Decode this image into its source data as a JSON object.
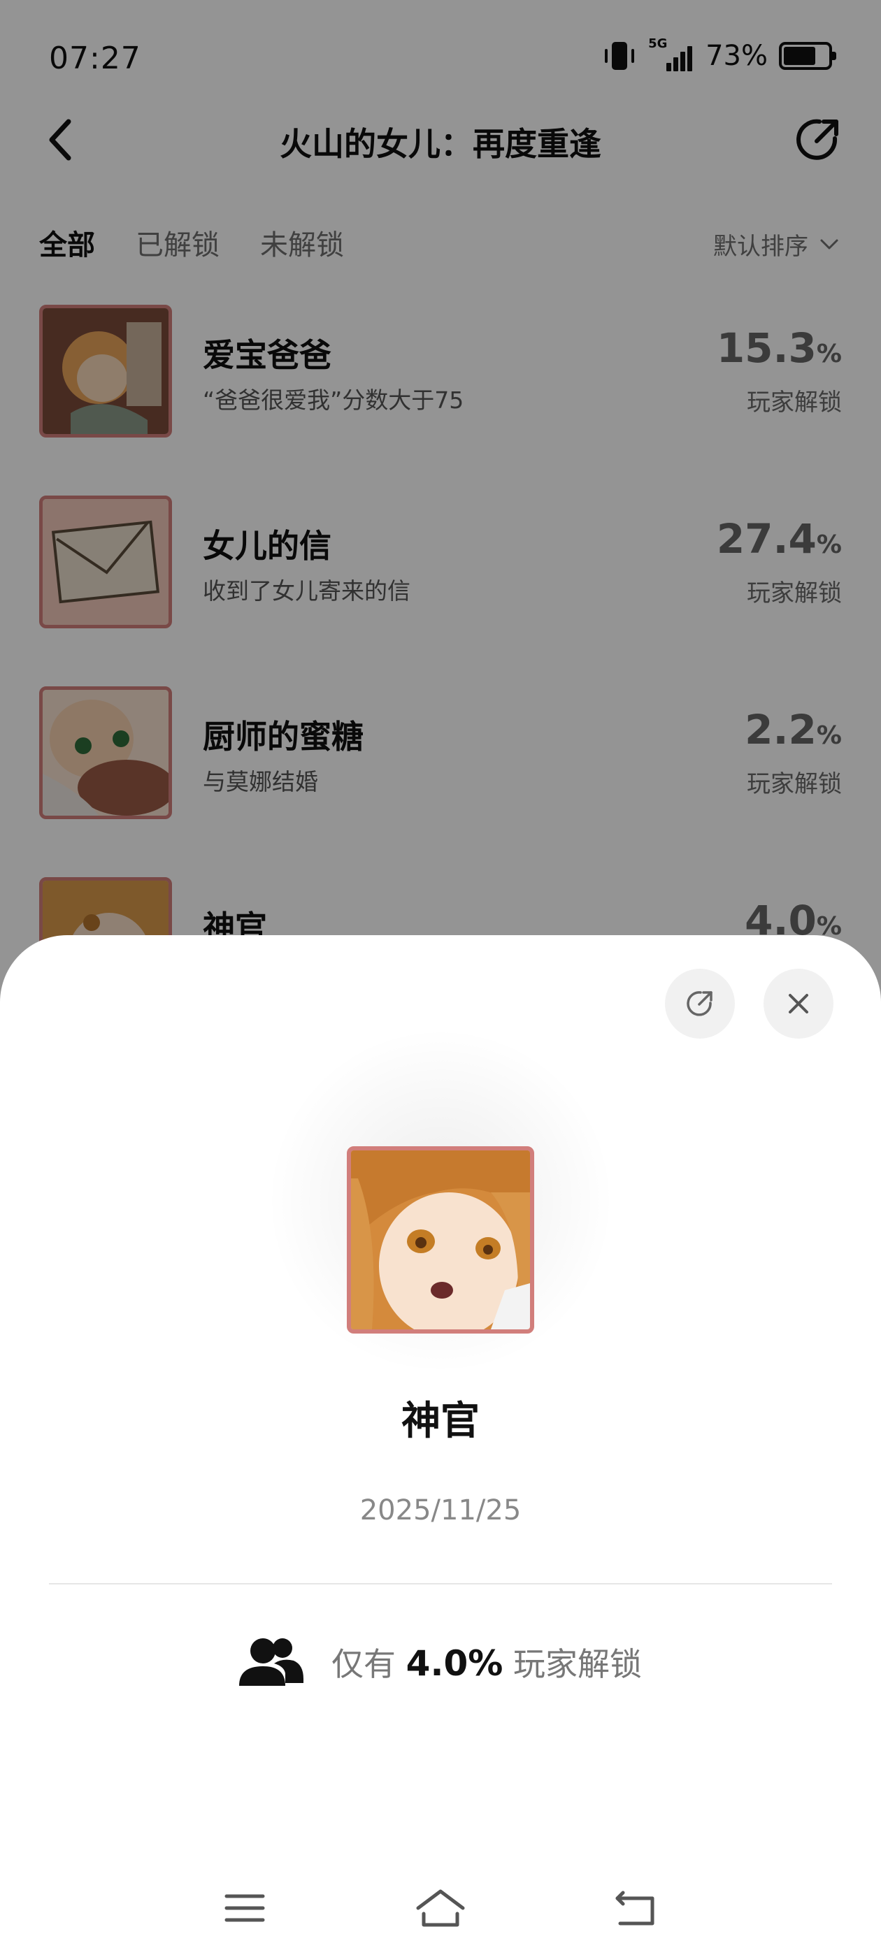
{
  "status_bar": {
    "time": "07:27",
    "network": "5G",
    "battery": "73%",
    "battery_level": 0.73,
    "icons": [
      "vibrate-icon",
      "signal-icon",
      "battery-icon"
    ]
  },
  "header": {
    "title": "火山的女儿：再度重逢",
    "back_icon": "chevron-left-icon",
    "share_icon": "share-icon"
  },
  "tabs": [
    {
      "label": "全部",
      "active": true
    },
    {
      "label": "已解锁",
      "active": false
    },
    {
      "label": "未解锁",
      "active": false
    }
  ],
  "sort": {
    "label": "默认排序",
    "icon": "chevron-down-icon"
  },
  "achievements": [
    {
      "title": "爱宝爸爸",
      "desc": "“爸爸很爱我”分数大于75",
      "pct": "15.3",
      "unit": "%",
      "pct_label": "玩家解锁"
    },
    {
      "title": "女儿的信",
      "desc": "收到了女儿寄来的信",
      "pct": "27.4",
      "unit": "%",
      "pct_label": "玩家解锁"
    },
    {
      "title": "厨师的蜜糖",
      "desc": "与莫娜结婚",
      "pct": "2.2",
      "unit": "%",
      "pct_label": "玩家解锁"
    },
    {
      "title": "神官",
      "desc": "",
      "pct": "4.0",
      "unit": "%",
      "pct_label": "玩家解锁"
    }
  ],
  "detail_sheet": {
    "title": "神官",
    "date": "2025/11/25",
    "rarity_prefix": "仅有",
    "rarity_value": "4.0%",
    "rarity_suffix": "玩家解锁",
    "share_icon": "share-icon",
    "close_icon": "close-icon",
    "players_icon": "users-icon"
  },
  "system_nav": {
    "icons": [
      "menu-icon",
      "home-icon",
      "back-icon"
    ]
  }
}
